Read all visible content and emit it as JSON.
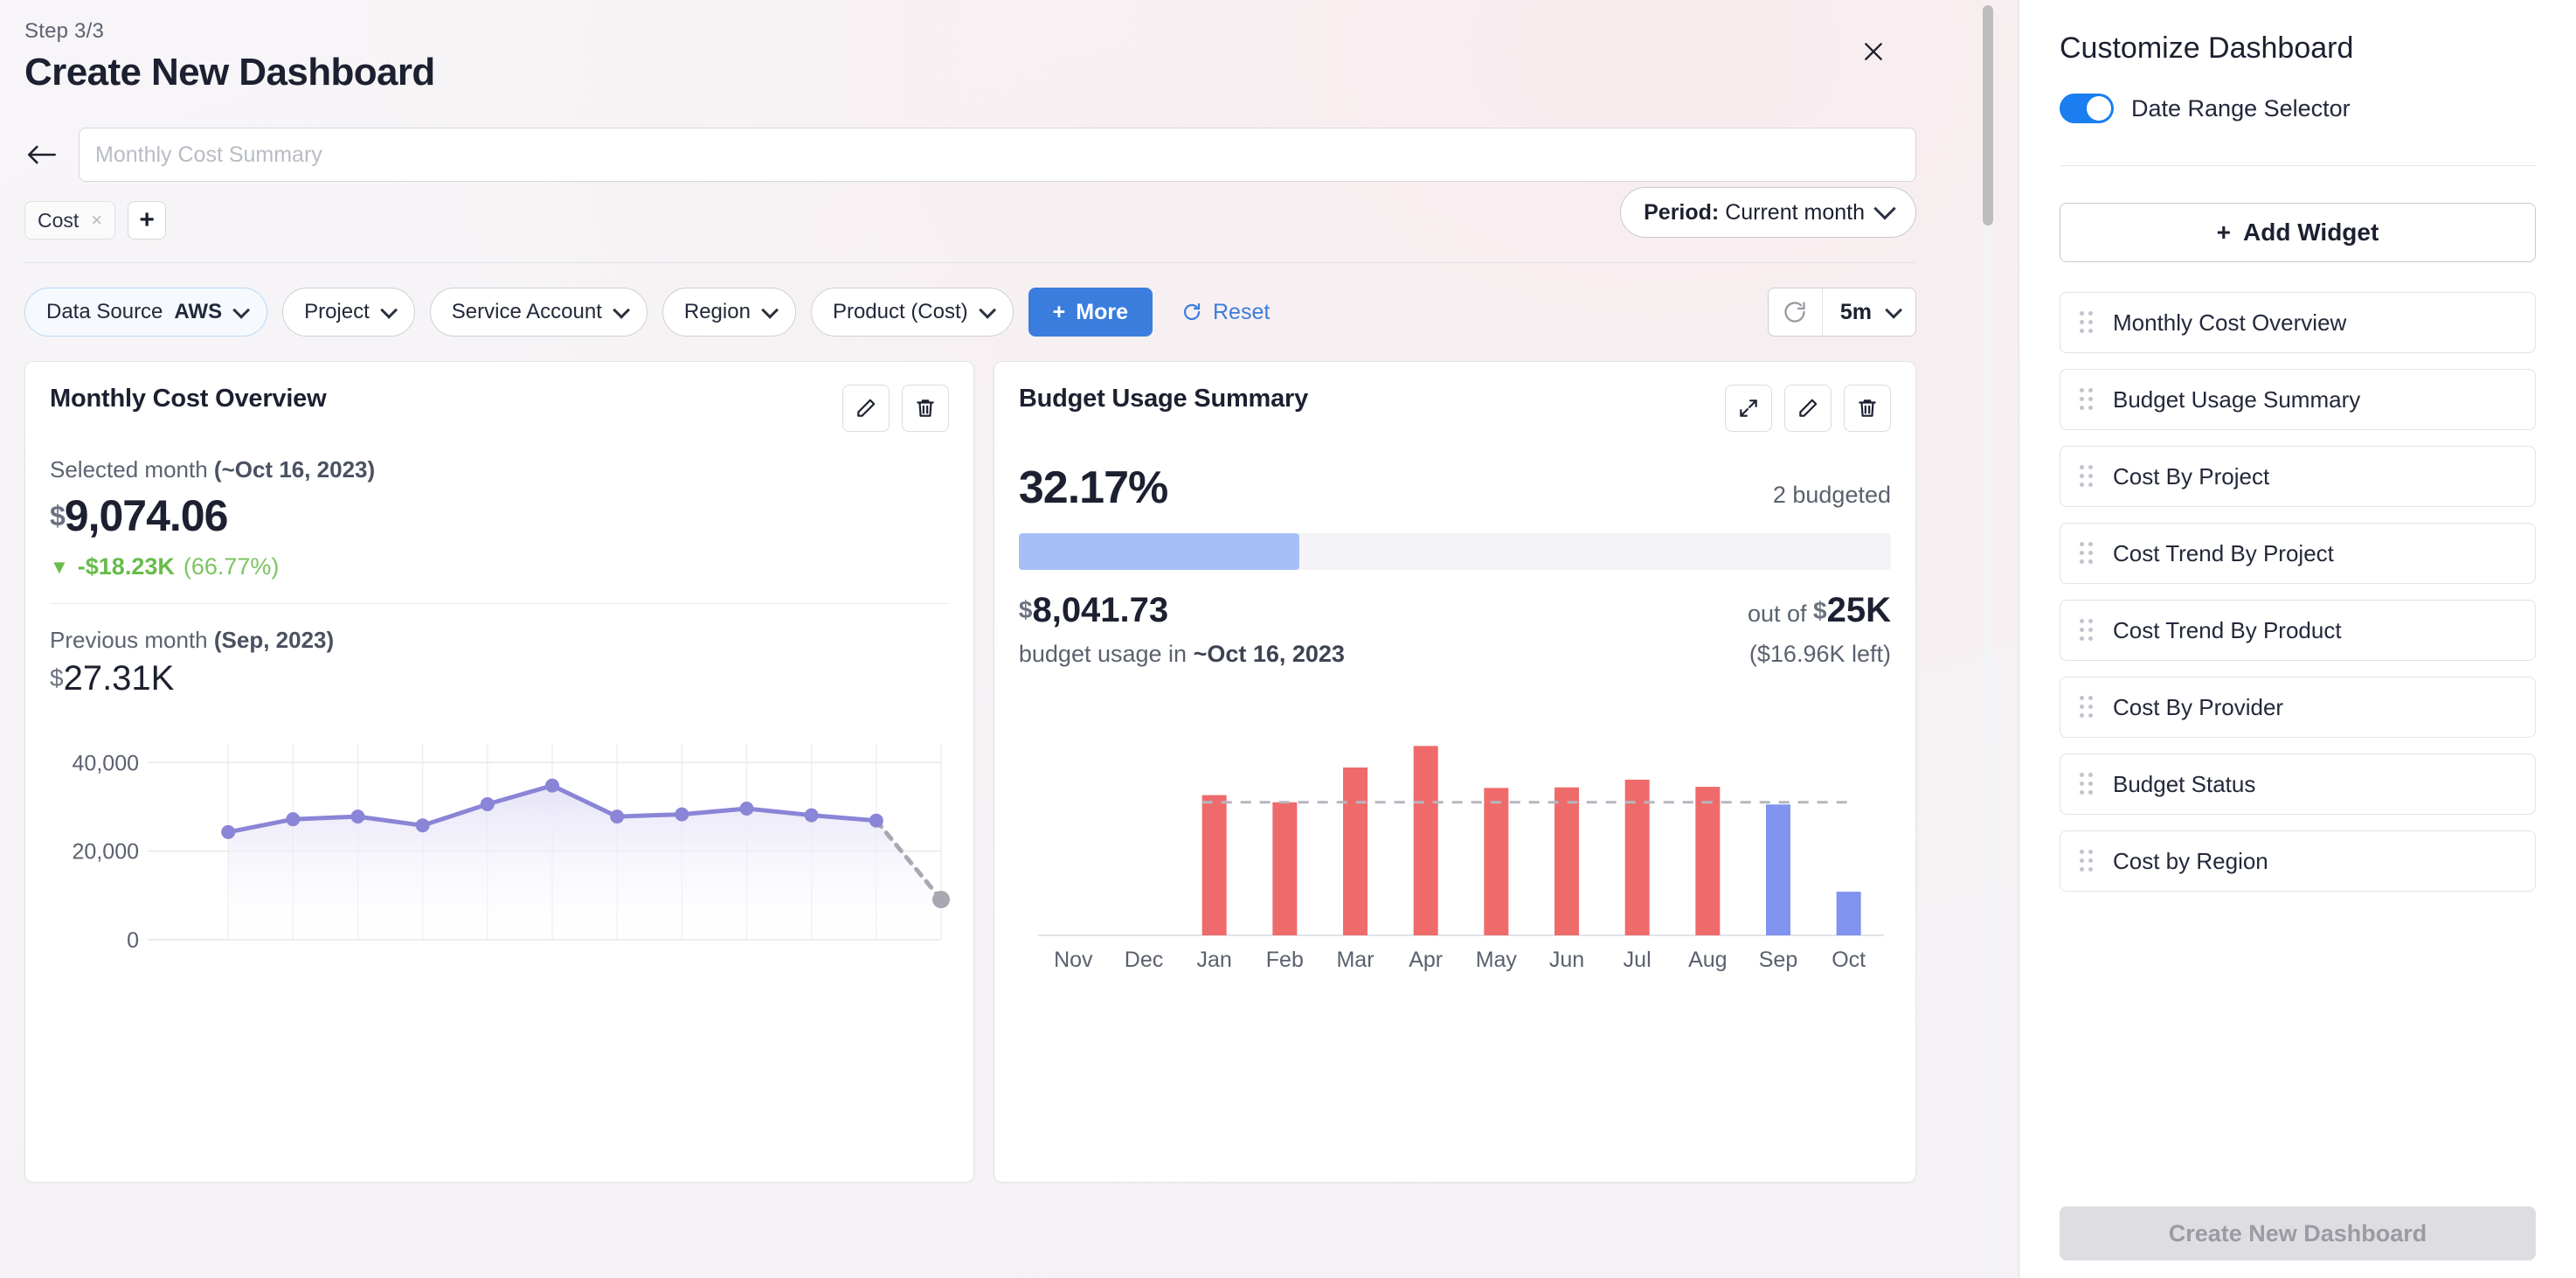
{
  "header": {
    "step": "Step 3/3",
    "title": "Create New Dashboard",
    "close_icon": "close-icon",
    "back_icon": "arrow-left-icon"
  },
  "name_field": {
    "value": "",
    "placeholder": "Monthly Cost Summary"
  },
  "tags": {
    "chips": [
      {
        "label": "Cost",
        "remove": "×"
      }
    ],
    "add_label": "+"
  },
  "period": {
    "prefix": "Period:",
    "value": "Current month"
  },
  "filters": {
    "items": [
      {
        "key": "Data Source",
        "value": "AWS",
        "active": true
      },
      {
        "key": "Project",
        "value": "",
        "active": false
      },
      {
        "key": "Service Account",
        "value": "",
        "active": false
      },
      {
        "key": "Region",
        "value": "",
        "active": false
      },
      {
        "key": "Product (Cost)",
        "value": "",
        "active": false
      }
    ],
    "more_label": "More",
    "more_plus": "+",
    "reset_label": "Reset",
    "refresh_interval": "5m"
  },
  "cards": {
    "monthly_cost_overview": {
      "title": "Monthly Cost Overview",
      "selected_label": "Selected month",
      "selected_date": "(~Oct 16, 2023)",
      "currency": "$",
      "amount": "9,074.06",
      "delta_arrow": "▼",
      "delta_amount": "-$18.23K",
      "delta_pct": "(66.77%)",
      "previous_label": "Previous month",
      "previous_date": "(Sep, 2023)",
      "previous_amount": "27.31K",
      "edit_icon": "pencil-icon",
      "delete_icon": "trash-icon"
    },
    "budget_usage_summary": {
      "title": "Budget Usage Summary",
      "percent": "32.17%",
      "budgeted_count": "2 budgeted",
      "progress_pct": 32.17,
      "spent_currency": "$",
      "spent": "8,041.73",
      "out_of_label": "out of",
      "budget_currency": "$",
      "budget_total": "25K",
      "usage_label": "budget usage in",
      "usage_date": "~Oct 16, 2023",
      "left_label": "($16.96K left)",
      "expand_icon": "expand-icon",
      "edit_icon": "pencil-icon",
      "delete_icon": "trash-icon"
    }
  },
  "chart_data": [
    {
      "type": "line",
      "title": "Monthly Cost Overview",
      "xlabel": "",
      "ylabel": "",
      "ylim": [
        0,
        45000
      ],
      "yticks": [
        0,
        20000,
        40000
      ],
      "ytick_labels": [
        "0",
        "20,000",
        "40,000"
      ],
      "grid": true,
      "legend": "none",
      "line_color": "#8a85d6",
      "fill_color": "#e4e2f6",
      "forecast_color": "#a8a8b2",
      "x": [
        1,
        2,
        3,
        4,
        5,
        6,
        7,
        8,
        9,
        10,
        11
      ],
      "values": [
        24300,
        27200,
        27800,
        25800,
        30600,
        34800,
        27800,
        28300,
        29600,
        28100,
        26900
      ],
      "forecast_point": {
        "x": 12,
        "value": 9074
      }
    },
    {
      "type": "bar",
      "title": "Budget Usage Summary",
      "categories": [
        "Nov",
        "Dec",
        "Jan",
        "Feb",
        "Mar",
        "Apr",
        "May",
        "Jun",
        "Jul",
        "Aug",
        "Sep",
        "Oct"
      ],
      "values": [
        0,
        0,
        25400,
        24100,
        30400,
        34300,
        26700,
        26800,
        28200,
        26900,
        23700,
        7900
      ],
      "bar_colors": [
        "#ef6b6b",
        "#ef6b6b",
        "#ef6b6b",
        "#ef6b6b",
        "#ef6b6b",
        "#ef6b6b",
        "#ef6b6b",
        "#ef6b6b",
        "#ef6b6b",
        "#ef6b6b",
        "#8093ef",
        "#8093ef"
      ],
      "threshold_line": 24100,
      "threshold_style": "dashed",
      "ylim": [
        0,
        38000
      ],
      "xlabel": "",
      "ylabel": "",
      "grid": false,
      "legend": "none"
    }
  ],
  "sidebar": {
    "title": "Customize Dashboard",
    "toggle": {
      "label": "Date Range Selector",
      "on": true
    },
    "add_widget_label": "Add Widget",
    "add_widget_plus": "+",
    "widgets": [
      {
        "label": "Monthly Cost Overview"
      },
      {
        "label": "Budget Usage Summary"
      },
      {
        "label": "Cost By Project"
      },
      {
        "label": "Cost Trend By Project"
      },
      {
        "label": "Cost Trend By Product"
      },
      {
        "label": "Cost By Provider"
      },
      {
        "label": "Budget Status"
      },
      {
        "label": "Cost by Region"
      }
    ],
    "create_button": "Create New Dashboard"
  },
  "colors": {
    "accent_blue": "#3b7ddd",
    "toggle_blue": "#1a7ef1",
    "green": "#67bb4a",
    "bar_red": "#ef6b6b",
    "bar_blue": "#8093ef",
    "line_purple": "#8a85d6"
  }
}
